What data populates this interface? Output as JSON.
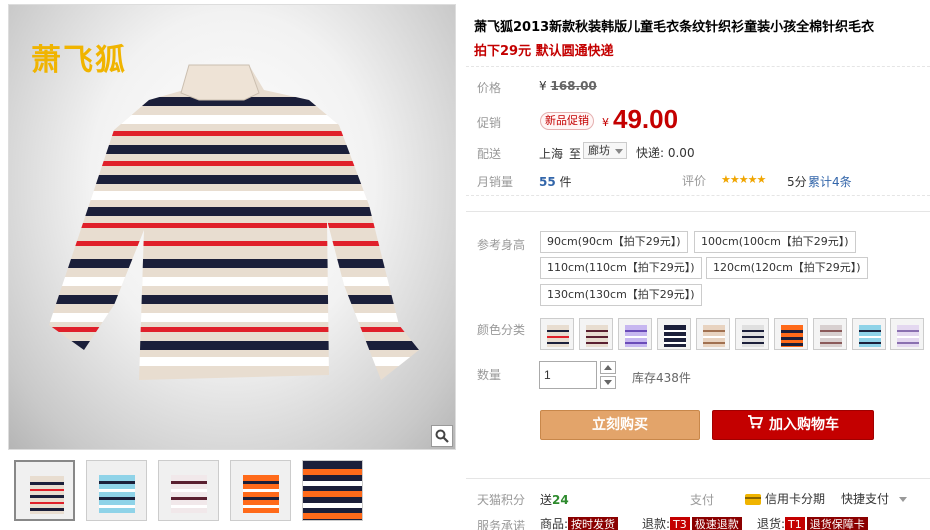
{
  "product": {
    "brand_logo": "萧飞狐",
    "title": "萧飞狐2013新款秋装韩版儿童毛衣条纹针织衫童装小孩全棉针织毛衣",
    "subtitle": "拍下29元 默认圆通快递"
  },
  "price": {
    "label": "价格",
    "currency": "¥",
    "original": "168.00",
    "promo_label": "促销",
    "promo_badge": "新品促销",
    "promo_price": "49.00"
  },
  "delivery": {
    "label": "配送",
    "from": "上海",
    "to_word": "至",
    "to_city": "廊坊",
    "express": "快递: 0.00"
  },
  "sales": {
    "label": "月销量",
    "count": "55",
    "unit": "件",
    "rating_label": "评价",
    "stars": "★★★★★",
    "score": "5分",
    "reviews": "累计4条"
  },
  "size": {
    "label": "参考身高",
    "options": [
      "90cm(90cm【拍下29元】)",
      "100cm(100cm【拍下29元】)",
      "110cm(110cm【拍下29元】)",
      "120cm(120cm【拍下29元】)",
      "130cm(130cm【拍下29元】)"
    ]
  },
  "color": {
    "label": "颜色分类",
    "swatch_count": 10
  },
  "quantity": {
    "label": "数量",
    "value": "1",
    "stock": "库存438件"
  },
  "actions": {
    "buy_now": "立刻购买",
    "add_cart": "加入购物车"
  },
  "footer": {
    "points_label": "天猫积分",
    "points_prefix": "送",
    "points_value": "24",
    "pay_label": "支付",
    "credit": "信用卡分期",
    "quick_pay": "快捷支付",
    "service_label": "服务承诺",
    "goods": "商品:",
    "goods_tag": "按时发货",
    "refund": "退款:",
    "refund_tag_code": "T3",
    "refund_tag": "极速退款",
    "return": "退货:",
    "return_tag_code": "T1",
    "return_tag": "退货保障卡"
  },
  "colors": {
    "accent_red": "#c40000",
    "buy_orange": "#e3a46a",
    "logo_gold": "#f0b400"
  }
}
